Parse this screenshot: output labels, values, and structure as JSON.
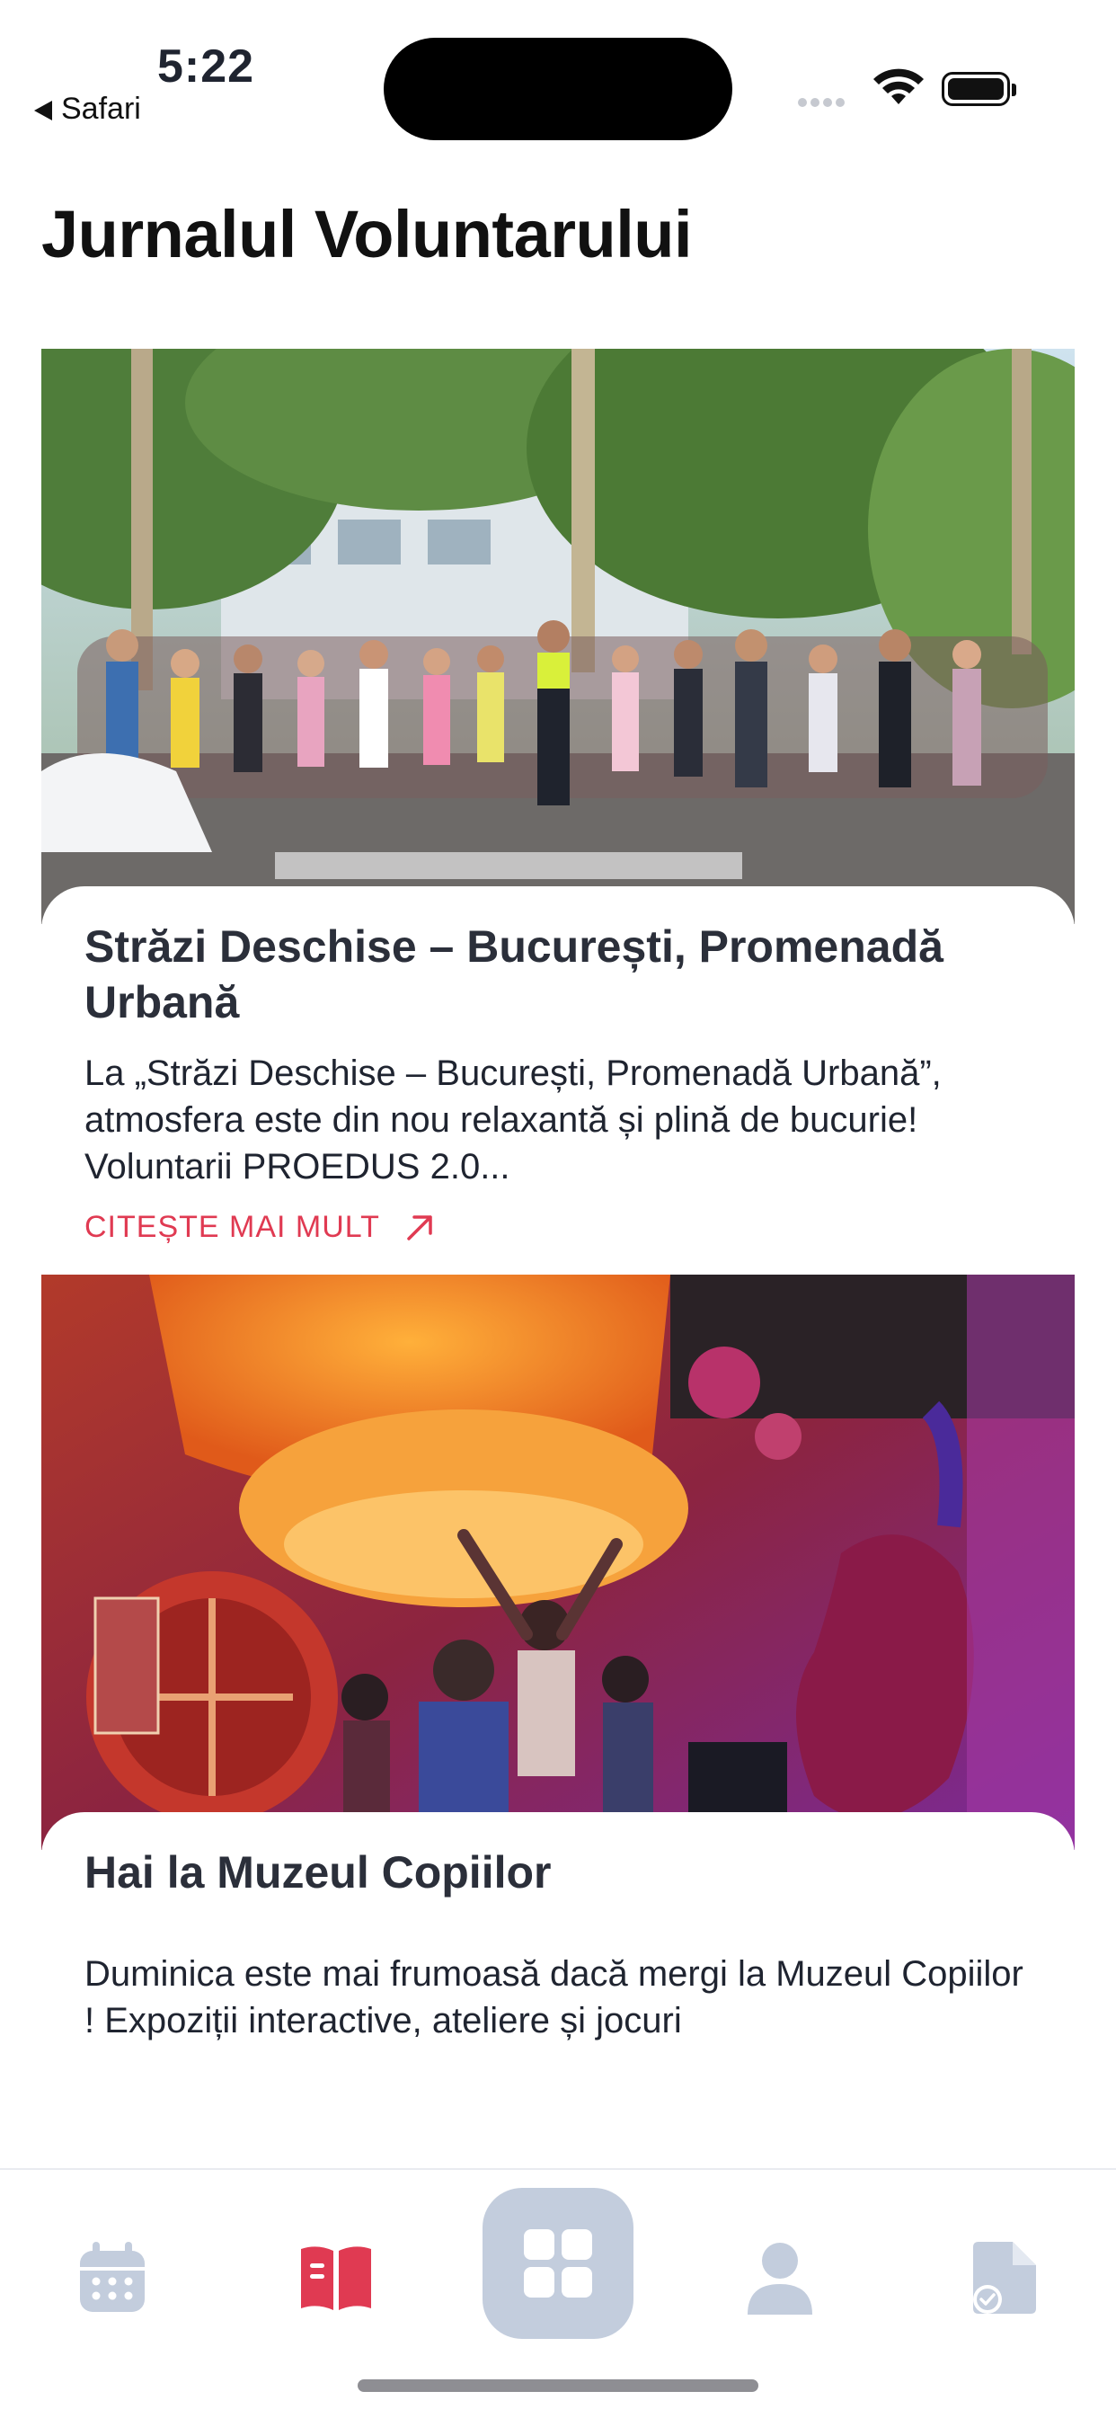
{
  "status_bar": {
    "time": "5:22",
    "back_app": "Safari"
  },
  "page": {
    "title": "Jurnalul Voluntarului"
  },
  "articles": [
    {
      "title": "Străzi Deschise – București, Promenadă Urbană",
      "excerpt": "La „Străzi Deschise – București, Promenadă Urbană”, atmosfera este din nou relaxantă și plină de bucurie! Voluntarii PROEDUS 2.0...",
      "read_more": "CITEȘTE MAI MULT",
      "image_icon": "street-event-photo"
    },
    {
      "title": "Hai la Muzeul Copiilor",
      "excerpt": "Duminica este mai frumoasă dacă mergi la Muzeul Copiilor ! Expoziții interactive, ateliere și jocuri",
      "image_icon": "children-museum-photo"
    }
  ],
  "bottom_nav": {
    "items": [
      {
        "icon": "calendar-icon",
        "active": false
      },
      {
        "icon": "book-open-icon",
        "active": true
      },
      {
        "icon": "grid-icon",
        "active": false
      },
      {
        "icon": "user-icon",
        "active": false
      },
      {
        "icon": "document-check-icon",
        "active": false
      }
    ]
  },
  "colors": {
    "accent": "#e03a52",
    "nav_inactive": "#c3cddd",
    "nav_center_bg": "#c3cddd"
  }
}
